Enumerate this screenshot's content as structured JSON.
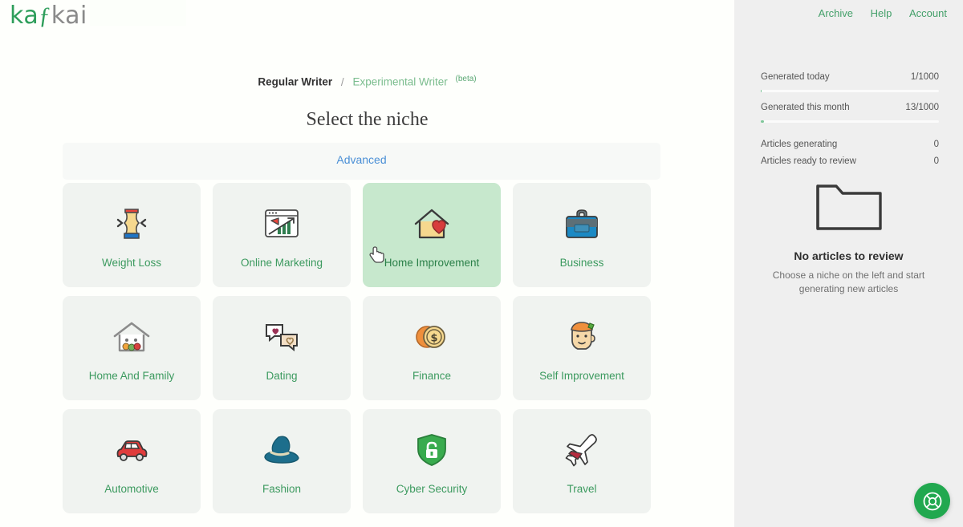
{
  "brand": {
    "name_part_1": "kaf",
    "name_part_2": "kai",
    "full": "kafkai"
  },
  "topnav": {
    "archive": "Archive",
    "help": "Help",
    "account": "Account"
  },
  "writer_tabs": {
    "regular": "Regular Writer",
    "separator": "/",
    "experimental": "Experimental Writer",
    "beta": "(beta)"
  },
  "page_title": "Select the niche",
  "advanced": {
    "label": "Advanced"
  },
  "niches": [
    {
      "label": "Weight Loss",
      "icon": "weight-loss-icon",
      "selected": false
    },
    {
      "label": "Online Marketing",
      "icon": "online-marketing-icon",
      "selected": false
    },
    {
      "label": "Home Improvement",
      "icon": "home-improvement-icon",
      "selected": true
    },
    {
      "label": "Business",
      "icon": "briefcase-icon",
      "selected": false
    },
    {
      "label": "Home And Family",
      "icon": "home-family-icon",
      "selected": false
    },
    {
      "label": "Dating",
      "icon": "dating-icon",
      "selected": false
    },
    {
      "label": "Finance",
      "icon": "coins-icon",
      "selected": false
    },
    {
      "label": "Self Improvement",
      "icon": "self-improvement-icon",
      "selected": false
    },
    {
      "label": "Automotive",
      "icon": "car-icon",
      "selected": false
    },
    {
      "label": "Fashion",
      "icon": "hat-icon",
      "selected": false
    },
    {
      "label": "Cyber Security",
      "icon": "shield-lock-icon",
      "selected": false
    },
    {
      "label": "Travel",
      "icon": "airplane-icon",
      "selected": false
    }
  ],
  "sidebar": {
    "stats": [
      {
        "label": "Generated today",
        "value": "1/1000",
        "percent": 0
      },
      {
        "label": "Generated this month",
        "value": "13/1000",
        "percent": 1.3
      }
    ],
    "counts": [
      {
        "label": "Articles generating",
        "value": "0"
      },
      {
        "label": "Articles ready to review",
        "value": "0"
      }
    ],
    "empty_state": {
      "icon": "folder-icon",
      "title": "No articles to review",
      "subtitle": "Choose a niche on the left and start generating new articles"
    },
    "help_fab": {
      "icon": "lifebuoy-icon"
    }
  },
  "colors": {
    "brand_green": "#2e9e5b",
    "label_green": "#3c9a5f",
    "selected_card": "#c7e8cd",
    "card_bg": "#f0f3f0",
    "advanced_blue": "#4a8fd6",
    "sidebar_bg": "#efefef",
    "fab_green": "#21a84f"
  }
}
